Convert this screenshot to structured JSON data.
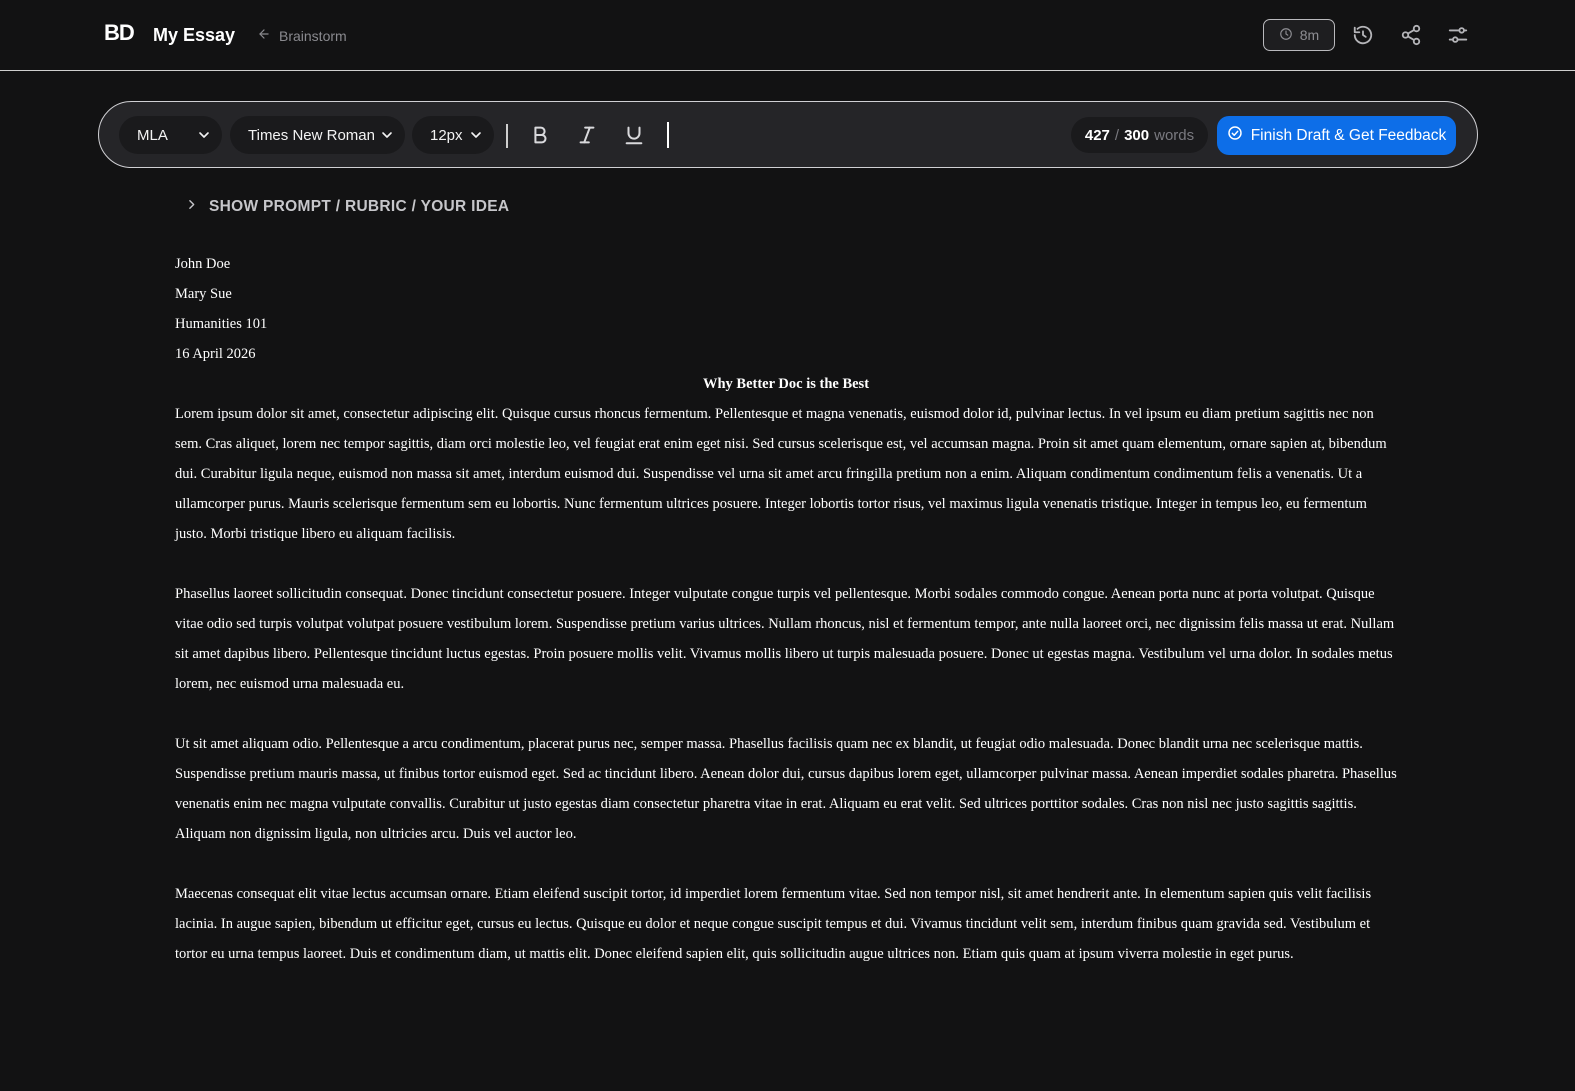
{
  "header": {
    "logo": "BD",
    "doc_title": "My Essay",
    "back_label": "Brainstorm",
    "timer": "8m"
  },
  "toolbar": {
    "style_value": "MLA",
    "font_value": "Times New Roman",
    "size_value": "12px",
    "word_count": "427",
    "word_separator": "/",
    "word_target": "300",
    "word_unit": "words",
    "finish_label": "Finish Draft & Get Feedback"
  },
  "prompt_toggle": "SHOW PROMPT / RUBRIC / YOUR IDEA",
  "essay": {
    "heading": [
      "John Doe",
      "Mary Sue",
      "Humanities 101",
      "16 April 2026"
    ],
    "title": "Why Better Doc is the Best",
    "paragraphs": [
      "Lorem ipsum dolor sit amet, consectetur adipiscing elit. Quisque cursus rhoncus fermentum. Pellentesque et magna venenatis, euismod dolor id, pulvinar lectus. In vel ipsum eu diam pretium sagittis nec non sem. Cras aliquet, lorem nec tempor sagittis, diam orci molestie leo, vel feugiat erat enim eget nisi. Sed cursus scelerisque est, vel accumsan magna. Proin sit amet quam elementum, ornare sapien at, bibendum dui. Curabitur ligula neque, euismod non massa sit amet, interdum euismod dui. Suspendisse vel urna sit amet arcu fringilla pretium non a enim. Aliquam condimentum condimentum felis a venenatis. Ut a ullamcorper purus. Mauris scelerisque fermentum sem eu lobortis. Nunc fermentum ultrices posuere. Integer lobortis tortor risus, vel maximus ligula venenatis tristique. Integer in tempus leo, eu fermentum justo. Morbi tristique libero eu aliquam facilisis.",
      "Phasellus laoreet sollicitudin consequat. Donec tincidunt consectetur posuere. Integer vulputate congue turpis vel pellentesque. Morbi sodales commodo congue. Aenean porta nunc at porta volutpat. Quisque vitae odio sed turpis volutpat volutpat posuere vestibulum lorem. Suspendisse pretium varius ultrices. Nullam rhoncus, nisl et fermentum tempor, ante nulla laoreet orci, nec dignissim felis massa ut erat. Nullam sit amet dapibus libero. Pellentesque tincidunt luctus egestas. Proin posuere mollis velit. Vivamus mollis libero ut turpis malesuada posuere. Donec ut egestas magna. Vestibulum vel urna dolor. In sodales metus lorem, nec euismod urna malesuada eu.",
      "Ut sit amet aliquam odio. Pellentesque a arcu condimentum, placerat purus nec, semper massa. Phasellus facilisis quam nec ex blandit, ut feugiat odio malesuada. Donec blandit urna nec scelerisque mattis. Suspendisse pretium mauris massa, ut finibus tortor euismod eget. Sed ac tincidunt libero. Aenean dolor dui, cursus dapibus lorem eget, ullamcorper pulvinar massa. Aenean imperdiet sodales pharetra. Phasellus venenatis enim nec magna vulputate convallis. Curabitur ut justo egestas diam consectetur pharetra vitae in erat. Aliquam eu erat velit. Sed ultrices porttitor sodales. Cras non nisl nec justo sagittis sagittis. Aliquam non dignissim ligula, non ultricies arcu. Duis vel auctor leo.",
      "Maecenas consequat elit vitae lectus accumsan ornare. Etiam eleifend suscipit tortor, id imperdiet lorem fermentum vitae. Sed non tempor nisl, sit amet hendrerit ante. In elementum sapien quis velit facilisis lacinia. In augue sapien, bibendum ut efficitur eget, cursus eu lectus. Quisque eu dolor et neque congue suscipit tempus et dui. Vivamus tincidunt velit sem, interdum finibus quam gravida sed. Vestibulum et tortor eu urna tempus laoreet. Duis et condimentum diam, ut mattis elit. Donec eleifend sapien elit, quis sollicitudin augue ultrices non. Etiam quis quam at ipsum viverra molestie in eget purus."
    ]
  },
  "icons": {
    "back": "arrow-left-icon",
    "timer": "clock-icon",
    "history": "history-icon",
    "share": "share-icon",
    "settings": "sliders-icon",
    "select": "chevron-down-icon",
    "bold": "bold-icon",
    "italic": "italic-icon",
    "underline": "underline-icon",
    "finish": "check-circle-icon",
    "prompt": "chevron-right-icon"
  },
  "colors": {
    "background": "#121213",
    "toolbar": "#252528",
    "accent": "#0d6ee8",
    "muted": "#8a8a8f"
  }
}
